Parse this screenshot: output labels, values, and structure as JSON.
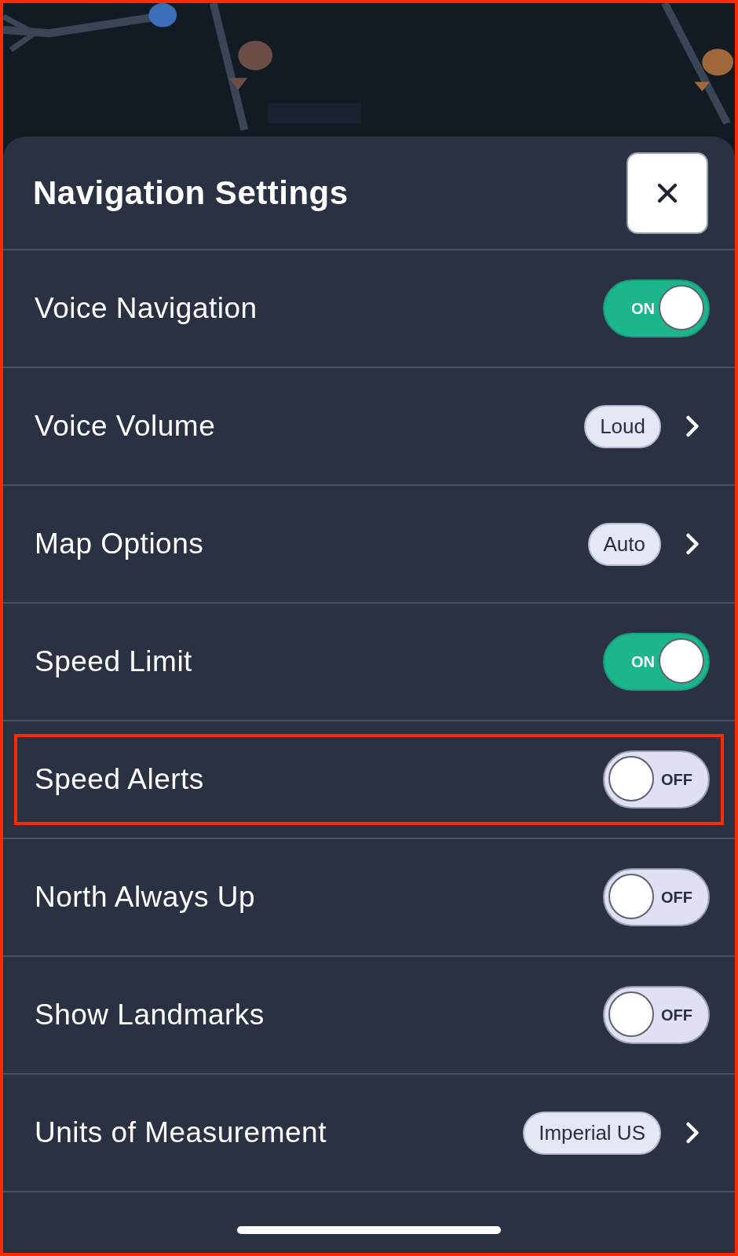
{
  "sheet": {
    "title": "Navigation Settings",
    "rows": [
      {
        "kind": "toggle",
        "label": "Voice Navigation",
        "on": true,
        "state_text": "ON",
        "highlighted": false
      },
      {
        "kind": "select",
        "label": "Voice Volume",
        "value": "Loud",
        "highlighted": false
      },
      {
        "kind": "select",
        "label": "Map Options",
        "value": "Auto",
        "highlighted": false
      },
      {
        "kind": "toggle",
        "label": "Speed Limit",
        "on": true,
        "state_text": "ON",
        "highlighted": false
      },
      {
        "kind": "toggle",
        "label": "Speed Alerts",
        "on": false,
        "state_text": "OFF",
        "highlighted": true
      },
      {
        "kind": "toggle",
        "label": "North Always Up",
        "on": false,
        "state_text": "OFF",
        "highlighted": false
      },
      {
        "kind": "toggle",
        "label": "Show Landmarks",
        "on": false,
        "state_text": "OFF",
        "highlighted": false
      },
      {
        "kind": "select",
        "label": "Units of Measurement",
        "value": "Imperial US",
        "highlighted": false
      }
    ]
  }
}
